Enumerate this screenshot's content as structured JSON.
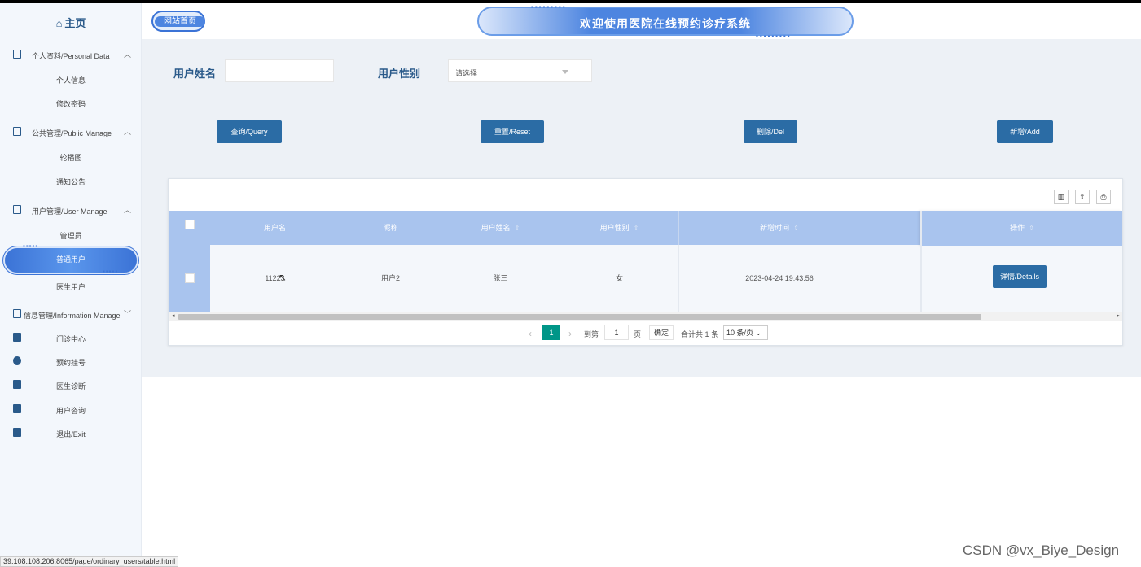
{
  "header": {
    "site_home": "网站首页",
    "title": "欢迎使用医院在线预约诊疗系统",
    "dots": "▪▪▪▪▪▪▪▪▪"
  },
  "sidebar": {
    "home": "主页",
    "home_icon": "⌂",
    "active_dots": "▪▪▪▪▪",
    "groups": [
      {
        "label": "个人资料/Personal Data",
        "icon": "document-icon",
        "children": [
          "个人信息",
          "修改密码"
        ]
      },
      {
        "label": "公共管理/Public Manage",
        "icon": "clipboard-icon",
        "children": [
          "轮播图",
          "通知公告"
        ]
      },
      {
        "label": "用户管理/User Manage",
        "icon": "building-icon",
        "children": [
          "管理员",
          "普通用户",
          "医生用户"
        ]
      },
      {
        "label": "信息管理/Information Manage",
        "icon": "chart-icon"
      }
    ],
    "items": [
      {
        "label": "门诊中心",
        "icon": "bookmark-icon"
      },
      {
        "label": "预约挂号",
        "icon": "award-icon"
      },
      {
        "label": "医生诊断",
        "icon": "calendar-icon"
      },
      {
        "label": "用户咨询",
        "icon": "calendar-check-icon"
      },
      {
        "label": "退出/Exit",
        "icon": "book-icon"
      }
    ]
  },
  "filters": {
    "name_label": "用户姓名",
    "name_value": "",
    "gender_label": "用户性别",
    "gender_placeholder": "请选择"
  },
  "buttons": {
    "query": "查询/Query",
    "reset": "重置/Reset",
    "delete": "删除/Del",
    "add": "新增/Add"
  },
  "toolbar": {
    "columns_icon": "▥",
    "export_icon": "⇪",
    "print_icon": "⎙"
  },
  "table": {
    "sort_glyph": "⇕",
    "columns": [
      "用户名",
      "昵称",
      "用户姓名",
      "用户性别",
      "新增时间",
      "",
      "操作"
    ],
    "rows": [
      {
        "username": "11223",
        "nickname": "用户2",
        "real_name": "张三",
        "gender": "女",
        "created": "2023-04-24 19:43:56",
        "action": "详情/Details"
      }
    ]
  },
  "pagination": {
    "prev": "‹",
    "next": "›",
    "current": "1",
    "goto_label": "到第",
    "goto_value": "1",
    "page_label": "页",
    "confirm": "确定",
    "total": "合计共 1 条",
    "page_size": "10 条/页",
    "scroll_left": "◂",
    "scroll_right": "▸"
  },
  "status_bar": {
    "url": "39.108.108.206:8065/page/ordinary_users/table.html"
  },
  "watermark": "CSDN @vx_Biye_Design",
  "colors": {
    "primary_button": "#2b6ca5",
    "header_row": "#a9c4ee",
    "active_menu": "#3b73d6",
    "pager_active": "#009688"
  }
}
